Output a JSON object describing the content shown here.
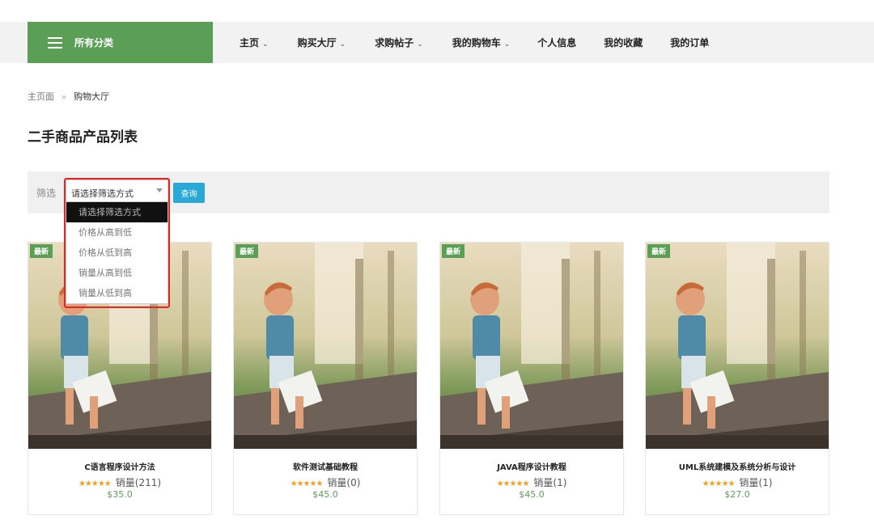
{
  "nav": {
    "category_label": "所有分类",
    "items": [
      {
        "label": "主页",
        "has_dropdown": true
      },
      {
        "label": "购买大厅",
        "has_dropdown": true
      },
      {
        "label": "求购帖子",
        "has_dropdown": true
      },
      {
        "label": "我的购物车",
        "has_dropdown": true
      },
      {
        "label": "个人信息",
        "has_dropdown": false
      },
      {
        "label": "我的收藏",
        "has_dropdown": false
      },
      {
        "label": "我的订单",
        "has_dropdown": false
      }
    ]
  },
  "breadcrumb": {
    "home": "主页面",
    "separator": "»",
    "current": "购物大厅"
  },
  "page_title": "二手商品产品列表",
  "filter": {
    "label": "筛选",
    "selected": "请选择筛选方式",
    "options": [
      "请选择筛选方式",
      "价格从高到低",
      "价格从低到高",
      "销量从高到低",
      "销量从低到高"
    ],
    "highlighted_option": "请选择筛选方式",
    "dropdown_open": true,
    "query_button": "查询"
  },
  "products": [
    {
      "badge": "最新",
      "name": "C语言程序设计方法",
      "stars": "★★★★★",
      "sales": "销量(211)",
      "price": "$35.0",
      "rating": 5
    },
    {
      "badge": "最新",
      "name": "软件测试基础教程",
      "stars": "★★★★★",
      "sales": "销量(0)",
      "price": "$45.0",
      "rating": 5
    },
    {
      "badge": "最新",
      "name": "JAVA程序设计教程",
      "stars": "★★★★★",
      "sales": "销量(1)",
      "price": "$45.0",
      "rating": 5
    },
    {
      "badge": "最新",
      "name": "UML系统建模及系统分析与设计",
      "stars": "★★★★★",
      "sales": "销量(1)",
      "price": "$27.0",
      "rating": 5
    }
  ],
  "colors": {
    "brand_green": "#5b9f56",
    "query_blue": "#2aa9d8",
    "highlight_red": "#e8231f",
    "star_orange": "#f0a020"
  },
  "icons": {
    "category": "hamburger-menu-icon",
    "nav_dropdown": "chevron-down-icon",
    "select": "caret-down-icon"
  }
}
